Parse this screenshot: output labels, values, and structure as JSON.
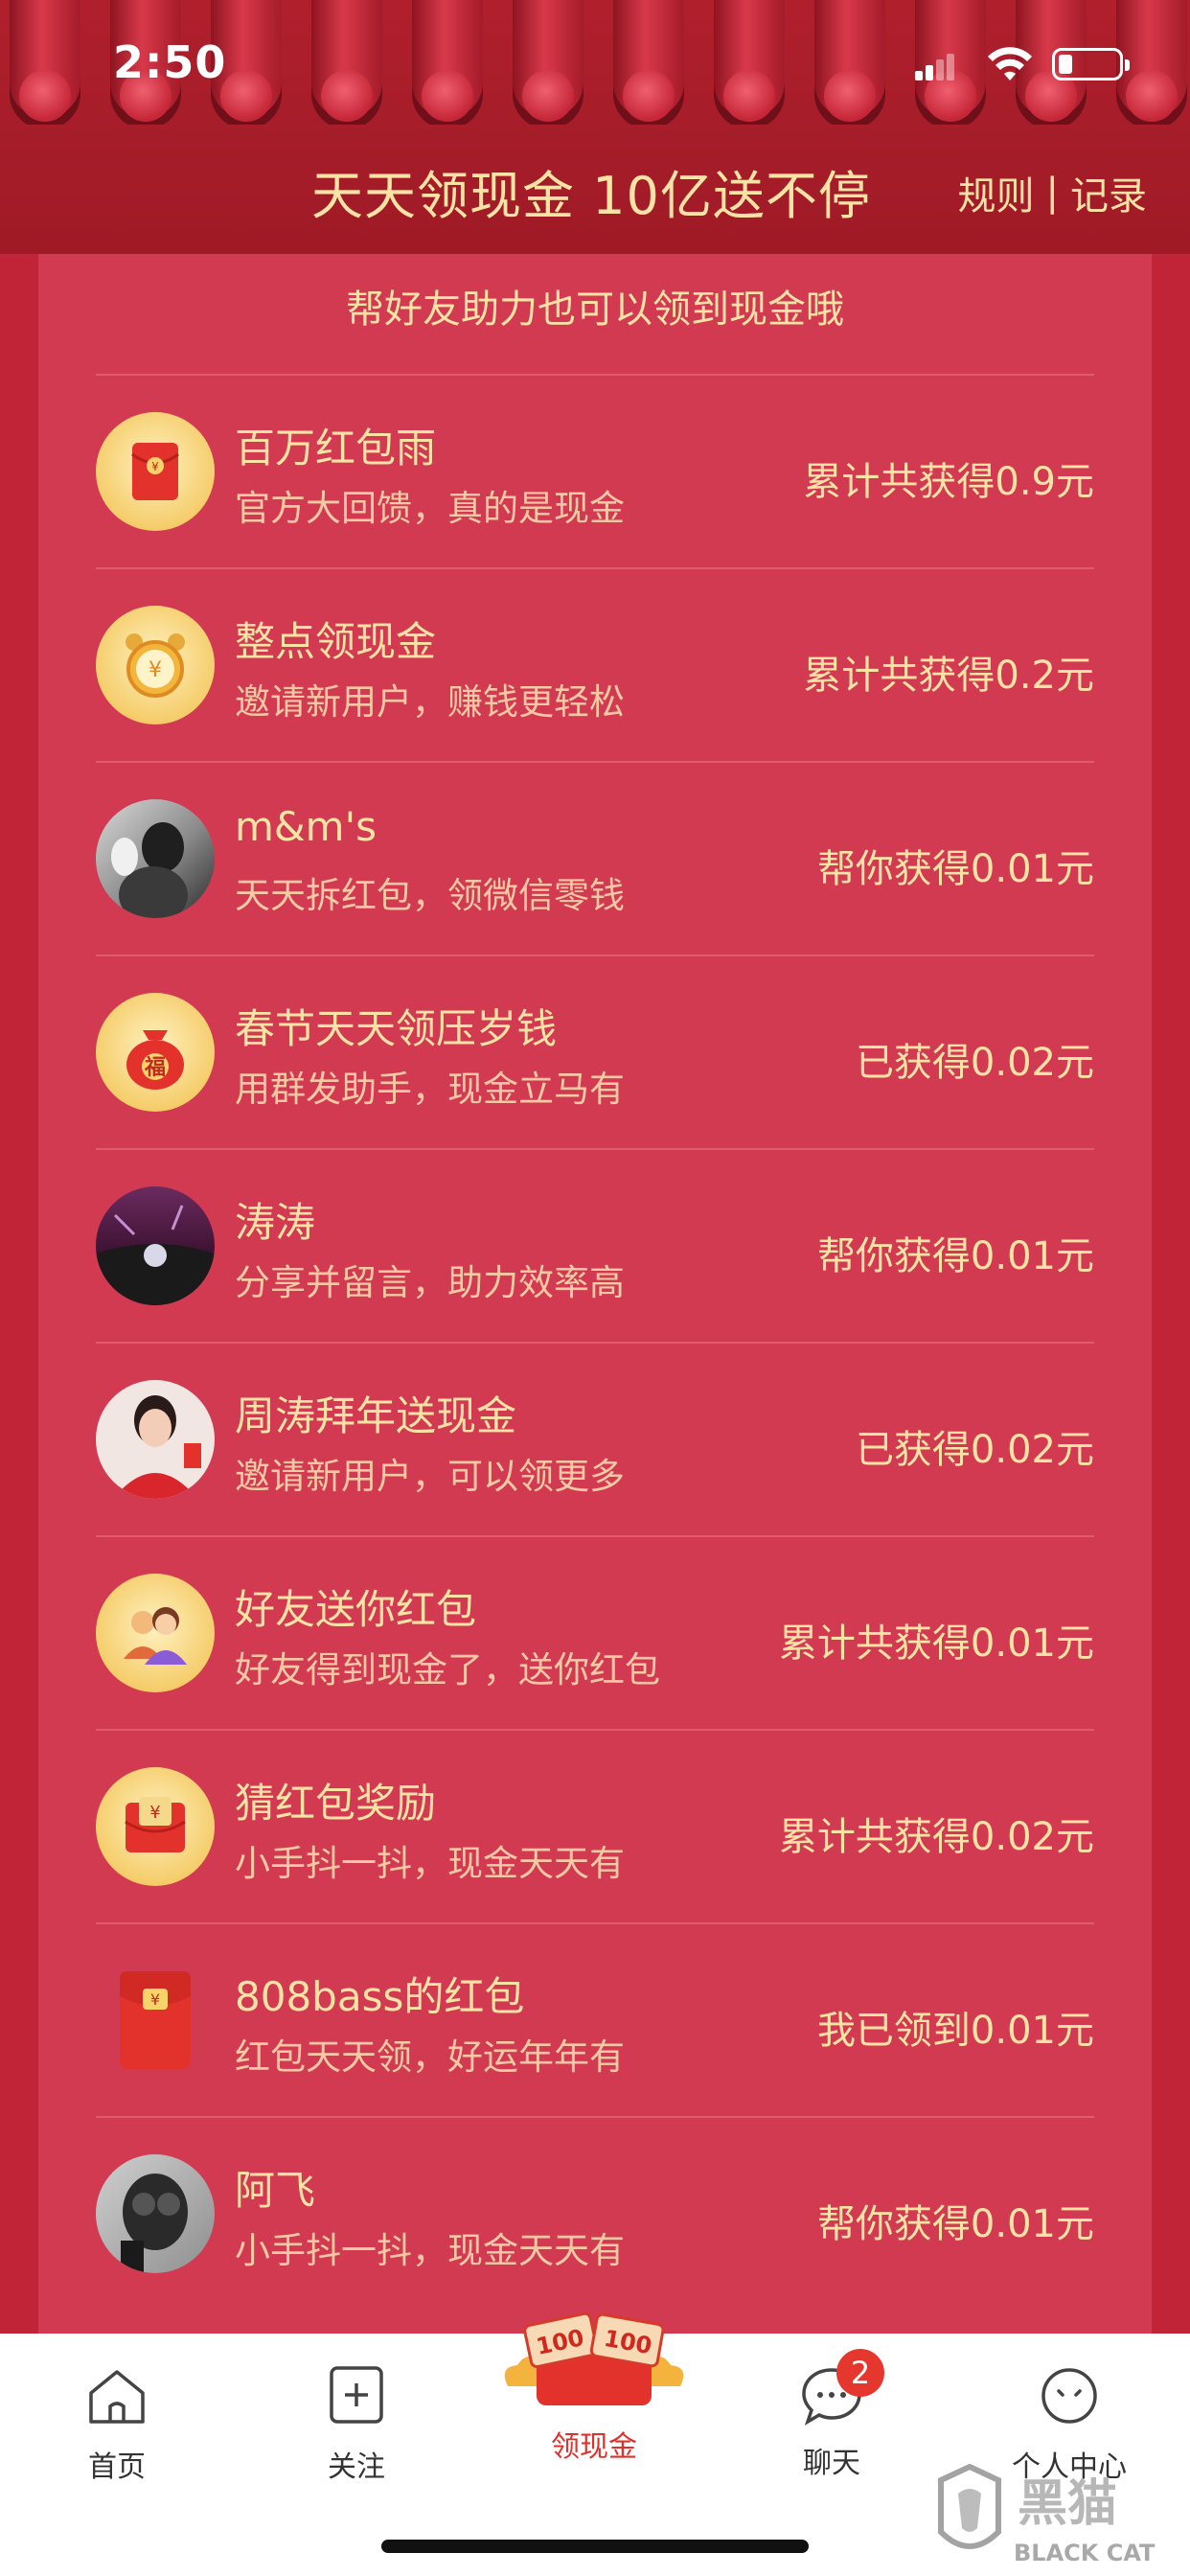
{
  "status_bar": {
    "time": "2:50"
  },
  "header": {
    "title": "天天领现金 10亿送不停",
    "rules_link": "规则",
    "separator": "|",
    "records_link": "记录"
  },
  "subtitle": "帮好友助力也可以领到现金哦",
  "items": [
    {
      "title": "百万红包雨",
      "subtitle": "官方大回馈，真的是现金",
      "amount": "累计共获得0.9元",
      "icon": "red-envelope-icon"
    },
    {
      "title": "整点领现金",
      "subtitle": "邀请新用户，赚钱更轻松",
      "amount": "累计共获得0.2元",
      "icon": "alarm-clock-icon"
    },
    {
      "title": "m&m's",
      "subtitle": "天天拆红包，领微信零钱",
      "amount": "帮你获得0.01元",
      "icon": "user-avatar"
    },
    {
      "title": "春节天天领压岁钱",
      "subtitle": "用群发助手，现金立马有",
      "amount": "已获得0.02元",
      "icon": "money-bag-icon",
      "icon_text": "福"
    },
    {
      "title": "涛涛",
      "subtitle": "分享并留言，助力效率高",
      "amount": "帮你获得0.01元",
      "icon": "user-avatar"
    },
    {
      "title": "周涛拜年送现金",
      "subtitle": "邀请新用户，可以领更多",
      "amount": "已获得0.02元",
      "icon": "user-avatar"
    },
    {
      "title": "好友送你红包",
      "subtitle": "好友得到现金了，送你红包",
      "amount": "累计共获得0.01元",
      "icon": "friends-icon"
    },
    {
      "title": "猜红包奖励",
      "subtitle": "小手抖一抖，现金天天有",
      "amount": "累计共获得0.02元",
      "icon": "red-envelope-icon"
    },
    {
      "title": "808bass的红包",
      "subtitle": "红包天天领，好运年年有",
      "amount": "我已领到0.01元",
      "icon": "red-packet-icon"
    },
    {
      "title": "阿飞",
      "subtitle": "小手抖一抖，现金天天有",
      "amount": "帮你获得0.01元",
      "icon": "user-avatar"
    }
  ],
  "tabbar": {
    "home": "首页",
    "follow": "关注",
    "cash": "领现金",
    "cash_badge_values": [
      "100",
      "100"
    ],
    "chat": "聊天",
    "chat_badge": "2",
    "profile": "个人中心"
  },
  "watermark": {
    "brand": "黑猫",
    "brand_en": "BLACK CAT"
  },
  "colors": {
    "header_bg": "#a51c29",
    "panel_bg": "#d13a51",
    "gold_text": "#fbe3a6",
    "tab_active": "#e0302a"
  }
}
